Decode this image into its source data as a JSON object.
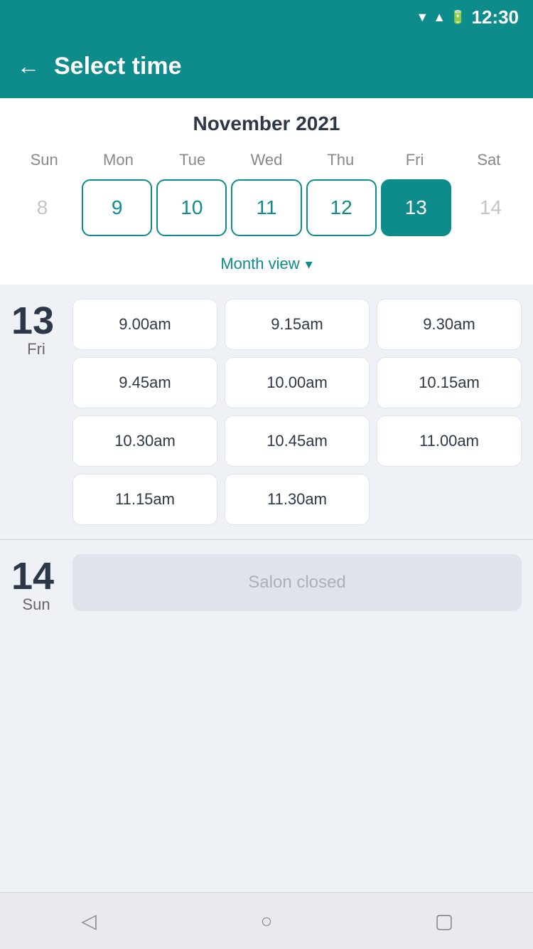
{
  "statusBar": {
    "time": "12:30"
  },
  "header": {
    "back_label": "←",
    "title": "Select time"
  },
  "calendar": {
    "month_year": "November 2021",
    "day_headers": [
      "Sun",
      "Mon",
      "Tue",
      "Wed",
      "Thu",
      "Fri",
      "Sat"
    ],
    "days": [
      {
        "number": "8",
        "state": "inactive"
      },
      {
        "number": "9",
        "state": "active"
      },
      {
        "number": "10",
        "state": "active"
      },
      {
        "number": "11",
        "state": "active"
      },
      {
        "number": "12",
        "state": "active"
      },
      {
        "number": "13",
        "state": "selected"
      },
      {
        "number": "14",
        "state": "inactive"
      }
    ],
    "month_view_label": "Month view"
  },
  "day_sections": [
    {
      "day_number": "13",
      "day_name": "Fri",
      "time_slots": [
        "9.00am",
        "9.15am",
        "9.30am",
        "9.45am",
        "10.00am",
        "10.15am",
        "10.30am",
        "10.45am",
        "11.00am",
        "11.15am",
        "11.30am"
      ],
      "closed": false
    },
    {
      "day_number": "14",
      "day_name": "Sun",
      "time_slots": [],
      "closed": true,
      "closed_label": "Salon closed"
    }
  ],
  "bottomNav": {
    "back_icon": "◁",
    "home_icon": "○",
    "recent_icon": "▢"
  }
}
